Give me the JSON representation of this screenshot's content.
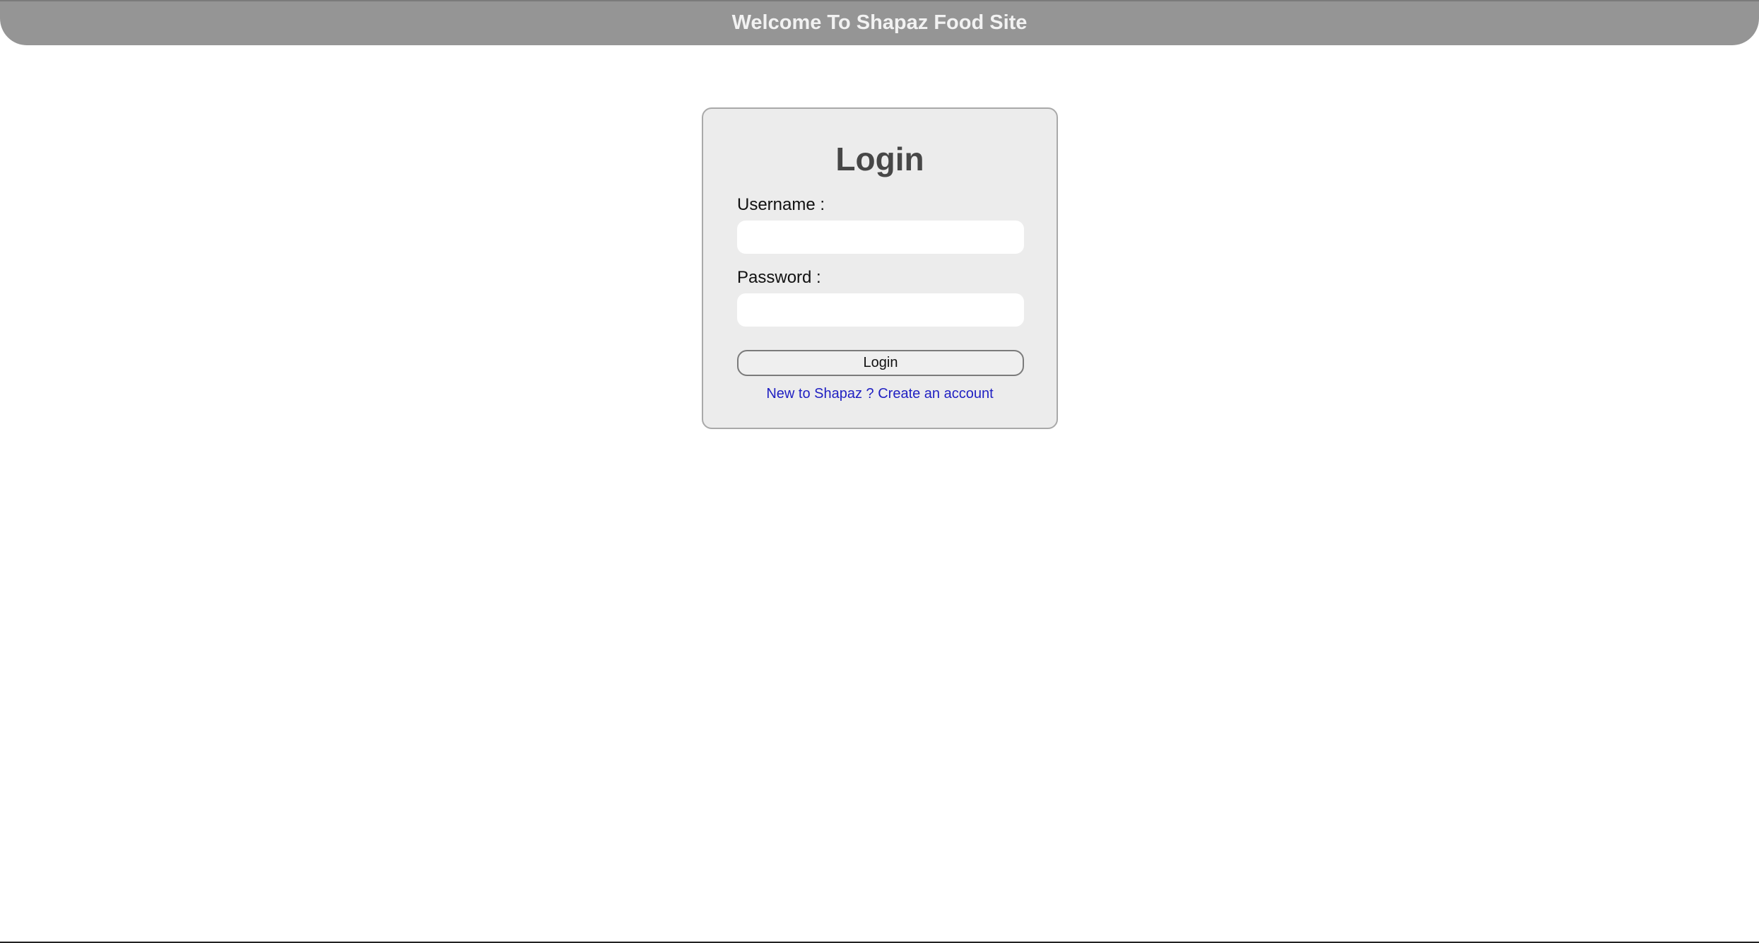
{
  "header": {
    "title": "Welcome To Shapaz Food Site"
  },
  "login_form": {
    "title": "Login",
    "username_label": "Username :",
    "username_value": "",
    "password_label": "Password :",
    "password_value": "",
    "submit_label": "Login",
    "signup_text": "New to Shapaz ? Create an account"
  },
  "colors": {
    "header_background": "#959595",
    "card_background": "#ececec",
    "link": "#1f1fc2"
  }
}
